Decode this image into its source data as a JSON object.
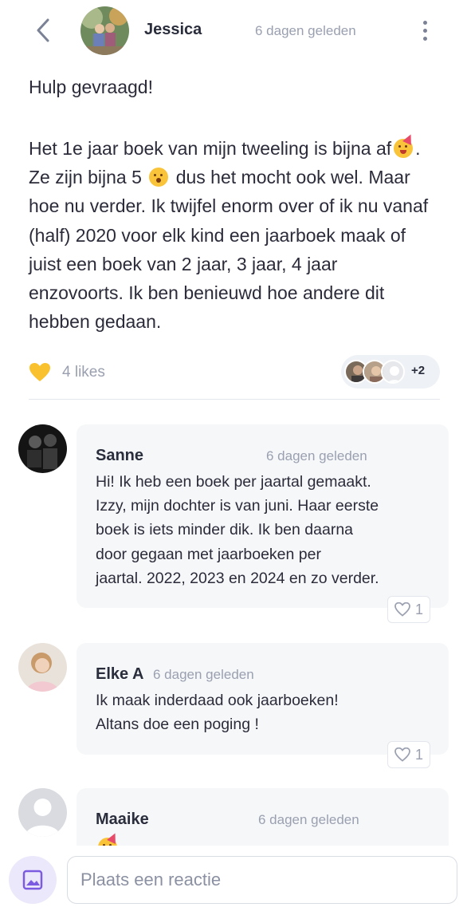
{
  "header": {
    "author": "Jessica",
    "time": "6 dagen geleden",
    "icons": {
      "back": "chevron-left-icon",
      "menu": "more-vertical-icon"
    }
  },
  "post": {
    "title": "Hulp gevraagd!",
    "body_part1": "Het 1e jaar boek van mijn tweeling is bijna af",
    "body_part2": ". Ze zijn bijna 5",
    "body_part3": " dus het mocht ook wel. Maar hoe nu verder. Ik twijfel enorm over of ik nu vanaf (half) 2020 voor elk kind een jaarboek maak of juist een boek van 2 jaar, 3 jaar, 4 jaar enzovoorts. Ik ben benieuwd hoe andere dit hebben gedaan.",
    "likes_label": "4 likes",
    "likers_more": "+2",
    "heart_color": "#F9C12E"
  },
  "comments": [
    {
      "name": "Sanne",
      "time": "6 dagen geleden",
      "text": "Hi! Ik heb een boek per jaartal gemaakt.\nIzzy, mijn dochter is van juni. Haar eerste\nboek is iets minder dik. Ik ben daarna\ndoor gegaan met jaarboeken per\njaartal. 2022, 2023 en 2024 en zo verder.",
      "likes": "1"
    },
    {
      "name": "Elke A",
      "time": "6 dagen geleden",
      "text": "Ik maak inderdaad ook jaarboeken!\nAltans doe een poging !",
      "likes": "1"
    },
    {
      "name": "Maaike",
      "time": "6 dagen geleden"
    }
  ],
  "composer": {
    "placeholder": "Plaats een reactie",
    "icon": "image-icon",
    "accent": "#7B5CE0"
  }
}
